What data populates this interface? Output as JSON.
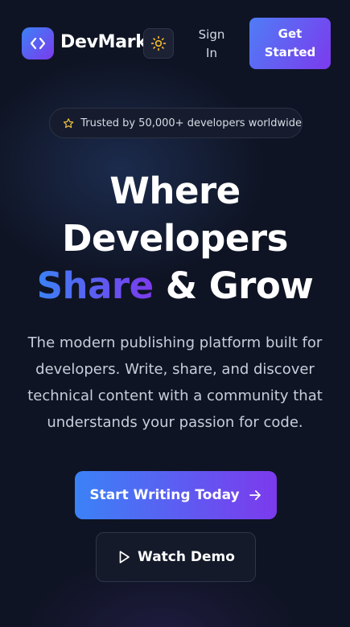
{
  "header": {
    "brand": "DevMark",
    "sign_in": "Sign In",
    "get_started": "Get Started"
  },
  "hero": {
    "badge_text": "Trusted by 50,000+ developers worldwide",
    "title_line1": "Where",
    "title_line2": "Developers",
    "title_highlight": "Share",
    "title_rest": " & Grow",
    "subtitle": "The modern publishing platform built for developers. Write, share, and discover technical content with a community that understands your passion for code.",
    "primary_cta": "Start Writing Today",
    "secondary_cta": "Watch Demo"
  },
  "icons": {
    "logo": "code-brackets-icon",
    "theme": "sun-icon",
    "badge": "star-icon",
    "cta": "arrow-right-icon",
    "demo": "play-icon"
  },
  "colors": {
    "background": "#0f1424",
    "accent_start": "#3b82f6",
    "accent_end": "#7c3aed",
    "sun": "#f5b82e",
    "star": "#f5c542"
  }
}
